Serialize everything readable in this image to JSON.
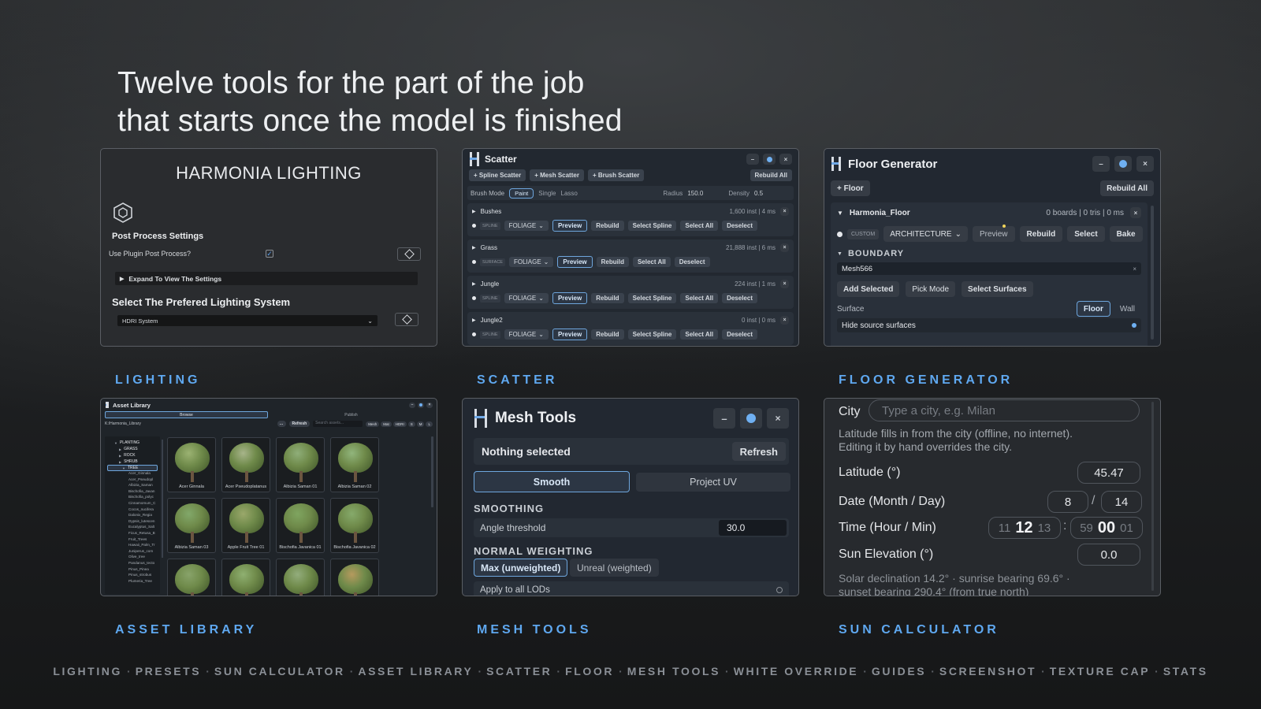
{
  "headline": {
    "line1": "Twelve tools for the part of the job",
    "line2": "that starts once the model is finished"
  },
  "captions": {
    "lighting": "LIGHTING",
    "scatter": "SCATTER",
    "floor": "FLOOR GENERATOR",
    "asset": "ASSET LIBRARY",
    "mesh": "MESH TOOLS",
    "sun": "SUN CALCULATOR"
  },
  "footer": [
    "LIGHTING",
    "PRESETS",
    "SUN CALCULATOR",
    "ASSET LIBRARY",
    "SCATTER",
    "FLOOR",
    "MESH TOOLS",
    "WHITE OVERRIDE",
    "GUIDES",
    "SCREENSHOT",
    "TEXTURE CAP",
    "STATS"
  ],
  "footer_sep": "·",
  "lighting": {
    "title": "HARMONIA LIGHTING",
    "section": "Post Process Settings",
    "use_label": "Use Plugin Post Process?",
    "use_checked": true,
    "expand": "Expand To View The Settings",
    "system_title": "Select The Prefered Lighting System",
    "system_value": "HDRI System"
  },
  "scatter": {
    "title": "Scatter",
    "tb_buttons": [
      "+ Spline Scatter",
      "+ Mesh Scatter",
      "+ Brush Scatter"
    ],
    "rebuild_all": "Rebuild All",
    "brush_mode": "Brush Mode",
    "modes": [
      "Paint",
      "Single",
      "Lasso"
    ],
    "radius_label": "Radius",
    "radius_value": "150.0",
    "density_label": "Density",
    "density_value": "0.5",
    "groups": [
      {
        "name": "Bushes",
        "stats": "1,600 inst | 4 ms",
        "tag": "SPLINE",
        "type": "FOLIAGE",
        "actions": [
          "Preview",
          "Rebuild",
          "Select Spline",
          "Select All",
          "Deselect"
        ]
      },
      {
        "name": "Grass",
        "stats": "21,888 inst | 6 ms",
        "tag": "SURFACE",
        "type": "FOLIAGE",
        "actions": [
          "Preview",
          "Rebuild",
          "Select All",
          "Deselect"
        ]
      },
      {
        "name": "Jungle",
        "stats": "224 inst | 1 ms",
        "tag": "SPLINE",
        "type": "FOLIAGE",
        "actions": [
          "Preview",
          "Rebuild",
          "Select Spline",
          "Select All",
          "Deselect"
        ]
      },
      {
        "name": "Jungle2",
        "stats": "0 inst | 0 ms",
        "tag": "SPLINE",
        "type": "FOLIAGE",
        "actions": [
          "Preview",
          "Rebuild",
          "Select Spline",
          "Select All",
          "Deselect"
        ]
      }
    ]
  },
  "floor": {
    "title": "Floor Generator",
    "add": "+ Floor",
    "rebuild_all": "Rebuild All",
    "item_name": "Harmonia_Floor",
    "item_stats": "0 boards | 0 tris | 0 ms",
    "tag": "CUSTOM",
    "type": "ARCHITECTURE",
    "actions": [
      "Preview",
      "Rebuild",
      "Select",
      "Bake"
    ],
    "boundary": "BOUNDARY",
    "mesh": "Mesh566",
    "boundary_buttons": [
      "Add Selected",
      "Pick Mode",
      "Select Surfaces"
    ],
    "surface_label": "Surface",
    "surface_options": [
      "Floor",
      "Wall"
    ],
    "hide_label": "Hide source surfaces"
  },
  "asset": {
    "title": "Asset Library",
    "tabs": [
      "Browse",
      "Publish"
    ],
    "path": "K:/Harmonia_Library",
    "refresh": "Refresh",
    "search_placeholder": "Search assets...",
    "filters": [
      "Mesh",
      "Mat",
      "HDRI",
      "S",
      "M",
      "L"
    ],
    "tree": [
      "PLANTING",
      "GRASS",
      "ROCK",
      "SHRUB",
      "TREE"
    ],
    "tree_items": [
      "Acer_Ginnala",
      "Acer_Pseudopl",
      "Albizia_Saman",
      "Bischofia_Javan",
      "Bischofia_polyc",
      "Cinnamomum_C",
      "Cocos_nucifera",
      "Dalonix_Regia",
      "Dypsis_lutescen",
      "Eucalyptus_Salt",
      "Ficus_Retusa_B",
      "Fruit_Trees",
      "Hawaii_Palm_Tr",
      "Juniperus_com",
      "Olive_tree",
      "Pandanus_tecto",
      "Pinus_Pinea",
      "Pinus_strobus",
      "Plumeria_Tree"
    ],
    "thumbs": [
      "Acer Ginnala",
      "Acer Pseudoplatanus",
      "Albizia Saman 01",
      "Albizia Saman 02",
      "Albizia Saman 03",
      "Apple Fruit Tree 01",
      "Bischofia Javanica 01",
      "Bischofia Javanica 02",
      "",
      "",
      "",
      ""
    ]
  },
  "mesh": {
    "title": "Mesh Tools",
    "status": "Nothing selected",
    "refresh": "Refresh",
    "modes": [
      "Smooth",
      "Project UV"
    ],
    "smoothing": "SMOOTHING",
    "angle_label": "Angle threshold",
    "angle_value": "30.0",
    "normal": "NORMAL WEIGHTING",
    "weight_options": [
      "Max (unweighted)",
      "Unreal (weighted)"
    ],
    "lods": "Apply to all LODs"
  },
  "sun": {
    "city_label": "City",
    "city_placeholder": "Type a city, e.g. Milan",
    "note1": "Latitude fills in from the city (offline, no internet).",
    "note2": "Editing it by hand overrides the city.",
    "lat_label": "Latitude (°)",
    "lat_value": "45.47",
    "date_label": "Date (Month / Day)",
    "month": "8",
    "date_sep": "/",
    "day": "14",
    "time_label": "Time (Hour / Min)",
    "hour_prev": "11",
    "hour": "12",
    "hour_next": "13",
    "time_sep": ":",
    "min_prev": "59",
    "min": "00",
    "min_next": "01",
    "elev_label": "Sun Elevation (°)",
    "elev_value": "0.0",
    "info1": "Solar declination 14.2° · sunrise bearing 69.6° ·",
    "info2": "sunset bearing 290.4° (from true north)"
  }
}
